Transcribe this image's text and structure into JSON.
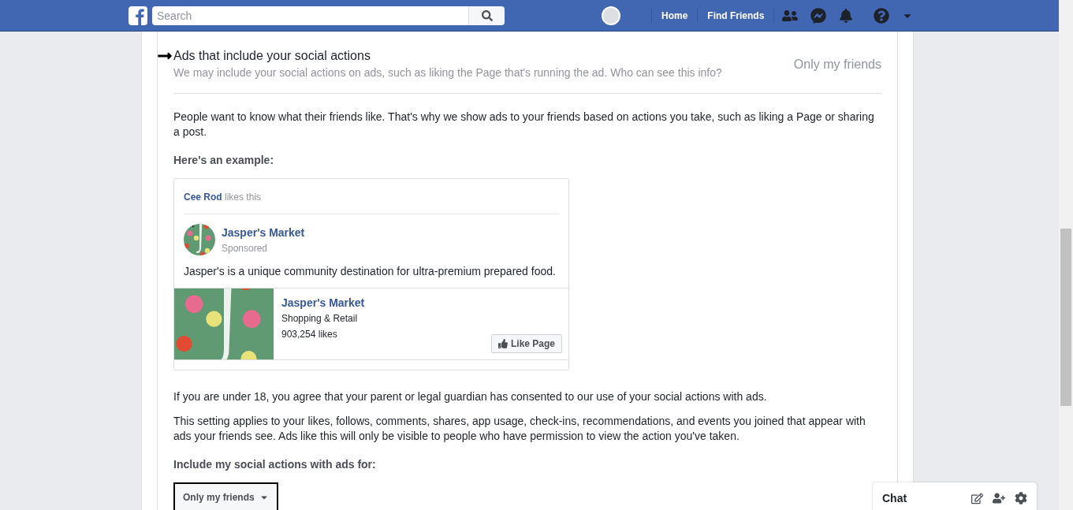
{
  "header": {
    "search": {
      "placeholder": "Search"
    },
    "nav": [
      "Home",
      "Find Friends"
    ]
  },
  "setting": {
    "title": "Ads that include your social actions",
    "description": "We may include your social actions on ads, such as liking the Page that's running the ad. Who can see this info?",
    "value": "Only my friends"
  },
  "intro": "People want to know what their friends like. That's why we show ads to your friends based on actions you take, such as liking a Page or sharing a post.",
  "example_heading": "Here's an example:",
  "ad": {
    "liker": "Cee Rod",
    "liker_suffix": "likes this",
    "page_name": "Jasper's Market",
    "sponsored": "Sponsored",
    "text": "Jasper's is a unique community destination for ultra-premium prepared food.",
    "link": {
      "name": "Jasper's Market",
      "category": "Shopping & Retail",
      "likes": "903,254 likes",
      "button": "Like Page"
    }
  },
  "notes": [
    "If you are under 18, you agree that your parent or legal guardian has consented to our use of your social actions with ads.",
    "This setting applies to your likes, follows, comments, shares, app usage, check-ins, recommendations, and events you joined that appear with ads your friends see. Ads like this will only be visible to people who have permission to view the action you've taken."
  ],
  "select_label": "Include my social actions with ads for:",
  "select": {
    "value": "Only my friends"
  },
  "chat": {
    "title": "Chat"
  }
}
